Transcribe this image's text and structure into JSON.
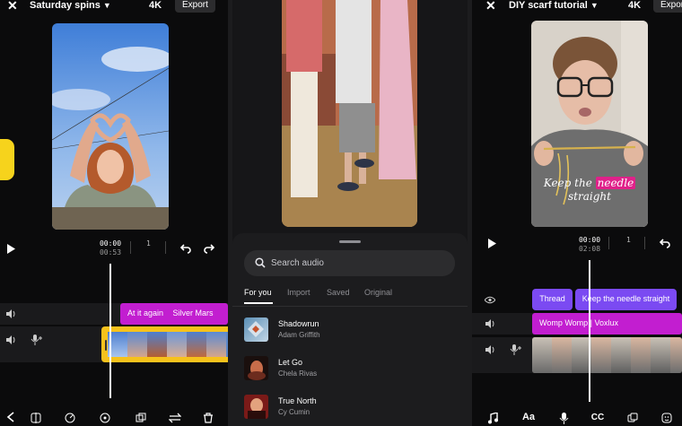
{
  "left_editor": {
    "title": "Saturday spins",
    "resolution": "4K",
    "export_label": "Export",
    "time_current": "00:00",
    "time_total": "00:53",
    "frame_counter": "1",
    "caption_clip": "At it again",
    "music_clip": "Silver Mars"
  },
  "audio_picker": {
    "search_placeholder": "Search audio",
    "tabs": [
      "For you",
      "Import",
      "Saved",
      "Original"
    ],
    "active_tab": "For you",
    "songs": [
      {
        "title": "Shadowrun",
        "artist": "Adam Griffith"
      },
      {
        "title": "Let Go",
        "artist": "Chela Rivas"
      },
      {
        "title": "True North",
        "artist": "Cy Cumin"
      }
    ]
  },
  "right_editor": {
    "title": "DIY scarf tutorial",
    "resolution": "4K",
    "export_label": "Export",
    "caption_pre": "Keep the ",
    "caption_highlight": "needle",
    "caption_post": "straight",
    "time_current": "00:00",
    "time_total": "02:08",
    "frame_counter": "1",
    "text_clip_1": "Thread",
    "text_clip_2": "Keep the needle straight",
    "music_clip": "Womp Womp | Voxlux",
    "bottom_cc": "CC",
    "bottom_aa": "Aa"
  },
  "colors": {
    "clip_magenta": "#c21ed0",
    "clip_violet": "#7b4af2",
    "selected_clip": "#f6c21c",
    "highlight_pink": "#e0218a"
  }
}
